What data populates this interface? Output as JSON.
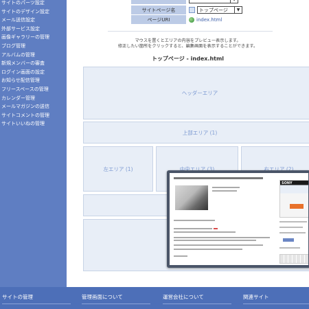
{
  "sidebar": {
    "items": [
      "サイトのパーツ設定",
      "サイトのデザイン設定",
      "メール送信設定",
      "外部サービス設定",
      "画像ギャラリーの管理",
      "ブログ管理",
      "アルバムの管理",
      "新規メンバーの審査",
      "ログイン画面の設定",
      "お知らせ配信管理",
      "フリースペースの管理",
      "カレンダー管理",
      "メールマガジンの送信",
      "サイトコメントの管理",
      "サイトいいねの管理"
    ]
  },
  "form": {
    "page_name_label": "サイトページ名",
    "page_name_value": "トップページ",
    "uri_label": "ページURI",
    "uri_value": "index.html"
  },
  "instructions": {
    "line1": "マウスを置くとエリアの内容をプレビュー表示します。",
    "line2": "修正したい箇所をクリックすると、編集画面を表示することができます。"
  },
  "section_title": "トップページ - index.html",
  "areas": {
    "header": "ヘッダーエリア",
    "top": "上部エリア (1)",
    "left": "左エリア (1)",
    "center": "中央エリア (3)",
    "right": "右エリア (2)"
  },
  "footer": {
    "items": [
      "サイトの管理",
      "管理画面について",
      "運営会社について",
      "関連サイト"
    ]
  },
  "preview": {
    "ad_brand": "SONY"
  },
  "colors": {
    "sidebar_bg": "#5f7ec2",
    "footer_bg": "#4d6fb8",
    "area_bg": "#e8eef7",
    "area_text": "#7d9ad2"
  }
}
